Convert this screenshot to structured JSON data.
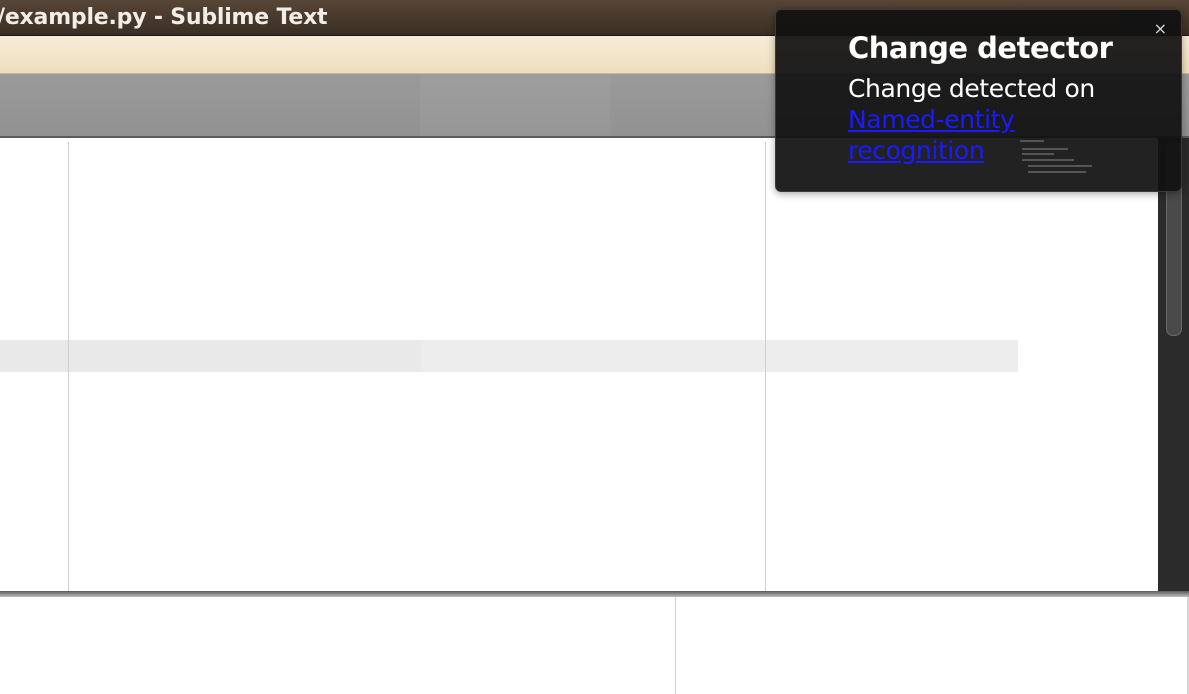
{
  "window": {
    "title": "/example.py - Sublime Text"
  },
  "notification": {
    "title": "Change detector",
    "body_text": "Change detected on",
    "link_text": "Named-entity recognition",
    "close_glyph": "×"
  },
  "colors": {
    "titlebar": "#4a3b2e",
    "menubar": "#f2e6cc",
    "tabbar": "#969696",
    "notification_bg": "#111111",
    "link": "#1a1aff",
    "current_line": "#ededed"
  }
}
